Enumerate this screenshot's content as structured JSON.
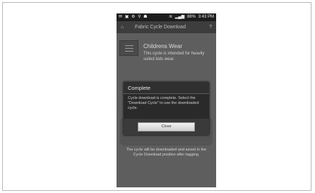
{
  "status_bar": {
    "left_icons": [
      "notification-icon",
      "gallery-icon",
      "sync-icon",
      "usb-icon",
      "android-icon"
    ],
    "left_glyphs": "✉ ▣ ⚙ ⚲ ☗",
    "battery": "88%",
    "time": "3:43 PM"
  },
  "app": {
    "title": "Fabric Cycle Download",
    "help": "?"
  },
  "cycle": {
    "name": "Childrens Wear",
    "description": "This cycle is intended for heavily soiled kids wear."
  },
  "info_text": "The cycle will be downloaded and saved in the Cycle Download position after tagging.",
  "dialog": {
    "title": "Complete",
    "message": "Cycle download is complete. Select the \"Download Cycle\" to use the downloaded cycle.",
    "close_label": "Close"
  }
}
